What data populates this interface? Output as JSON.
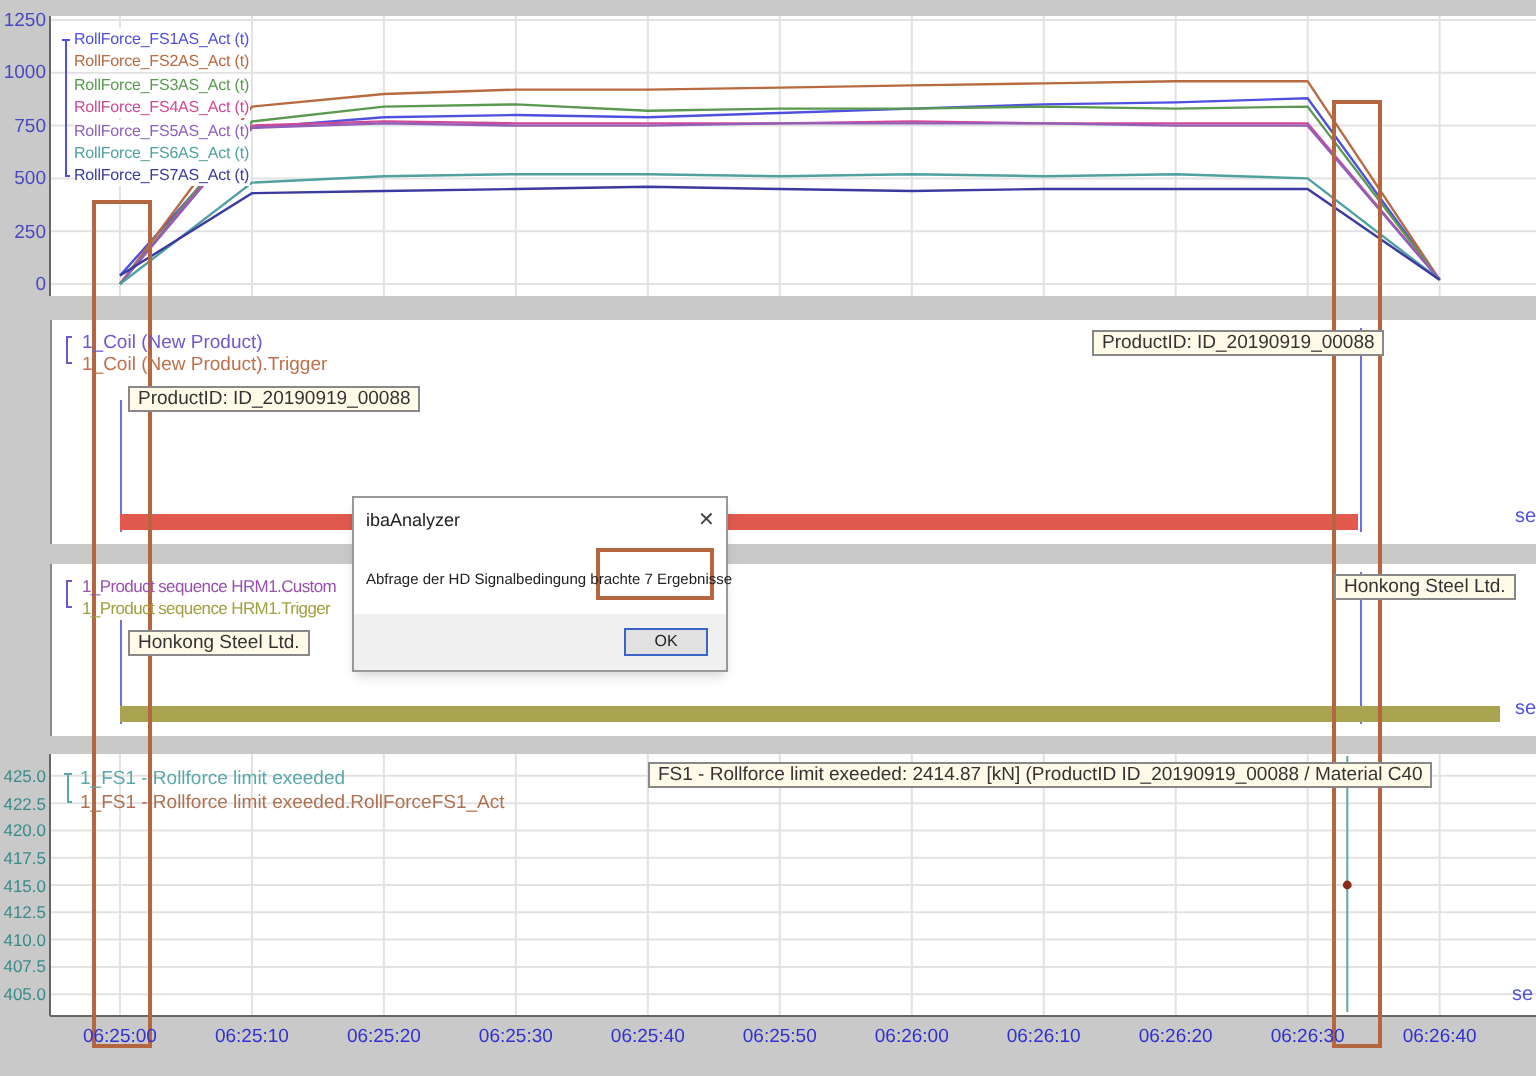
{
  "force_panel": {
    "chart_data": {
      "type": "line",
      "grid": true,
      "categories": [
        null,
        null,
        null,
        null,
        null,
        null,
        null,
        null,
        null,
        null,
        null
      ],
      "ylim": [
        -57,
        1269
      ],
      "yticks": [
        0,
        250,
        500,
        750,
        1000,
        1250
      ],
      "series": [
        {
          "name": "RollForce_FS1AS_Act (t)",
          "color": "#5050e0",
          "values": [
            40,
            740,
            790,
            800,
            790,
            810,
            830,
            850,
            860,
            880,
            20
          ]
        },
        {
          "name": "RollForce_FS2AS_Act (t)",
          "color": "#b86a40",
          "values": [
            0,
            840,
            900,
            920,
            920,
            930,
            940,
            950,
            960,
            960,
            20
          ]
        },
        {
          "name": "RollForce_FS3AS_Act (t)",
          "color": "#5a9a50",
          "values": [
            0,
            770,
            840,
            850,
            820,
            830,
            830,
            840,
            830,
            840,
            20
          ]
        },
        {
          "name": "RollForce_FS4AS_Act (t)",
          "color": "#d04898",
          "values": [
            0,
            750,
            770,
            760,
            760,
            760,
            770,
            760,
            760,
            760,
            20
          ]
        },
        {
          "name": "RollForce_FS5AS_Act (t)",
          "color": "#9060b8",
          "values": [
            0,
            740,
            760,
            750,
            750,
            760,
            760,
            760,
            750,
            750,
            20
          ]
        },
        {
          "name": "RollForce_FS6AS_Act (t)",
          "color": "#50a0a0",
          "values": [
            0,
            480,
            510,
            520,
            520,
            510,
            520,
            510,
            520,
            500,
            20
          ]
        },
        {
          "name": "RollForce_FS7AS_Act (t)",
          "color": "#3a3aa0",
          "values": [
            40,
            430,
            440,
            450,
            460,
            450,
            440,
            450,
            450,
            450,
            20
          ]
        }
      ]
    }
  },
  "coil_panel": {
    "kind": "coil",
    "legend": [
      {
        "label": "1_Coil (New Product)",
        "color": "#6a5ad0"
      },
      {
        "label": "1_Coil (New Product).Trigger",
        "color": "#c0704a"
      }
    ],
    "annotations": [
      "ProductID: ID_20190919_00088",
      "ProductID: ID_20190919_00088"
    ],
    "unit": "se"
  },
  "sequence_panel": {
    "kind": "sequence",
    "legend": [
      {
        "label": "1_Product sequence HRM1.Custom",
        "color": "#9a50b0"
      },
      {
        "label": "1_Product sequence HRM1.Trigger",
        "color": "#a0a040"
      }
    ],
    "annotations": [
      "Honkong Steel Ltd.",
      "Honkong Steel Ltd."
    ],
    "unit": "se"
  },
  "limit_panel": {
    "event_legend": {
      "label": "1_FS1 - Rollforce limit exeeded",
      "color": "#5aa8a8"
    },
    "annotation": "FS1 - Rollforce limit exeeded: 2414.87 [kN] (ProductID ID_20190919_00088 / Material C40",
    "unit": "se",
    "chart_data": {
      "type": "scatter",
      "grid": true,
      "ref_lines": [
        {
          "axis": "x",
          "value": 23193,
          "color": "#5aa8a8"
        }
      ],
      "x": [
        23193
      ],
      "xlim": [
        23094.7,
        23207.3
      ],
      "ylim": [
        403,
        427
      ],
      "yticks": [
        {
          "value": 405,
          "label": "405.0"
        },
        {
          "value": 407.5,
          "label": "407.5"
        },
        {
          "value": 410,
          "label": "410.0"
        },
        {
          "value": 412.5,
          "label": "412.5"
        },
        {
          "value": 415,
          "label": "415.0"
        },
        {
          "value": 417.5,
          "label": "417.5"
        },
        {
          "value": 420,
          "label": "420.0"
        },
        {
          "value": 422.5,
          "label": "422.5"
        },
        {
          "value": 425,
          "label": "425.0"
        }
      ],
      "xticks": [
        {
          "value": 23100,
          "label": "06:25:00"
        },
        {
          "value": 23110,
          "label": "06:25:10"
        },
        {
          "value": 23120,
          "label": "06:25:20"
        },
        {
          "value": 23130,
          "label": "06:25:30"
        },
        {
          "value": 23140,
          "label": "06:25:40"
        },
        {
          "value": 23150,
          "label": "06:25:50"
        },
        {
          "value": 23160,
          "label": "06:26:00"
        },
        {
          "value": 23170,
          "label": "06:26:10"
        },
        {
          "value": 23180,
          "label": "06:26:20"
        },
        {
          "value": 23190,
          "label": "06:26:30"
        },
        {
          "value": 23200,
          "label": "06:26:40"
        }
      ],
      "series": [
        {
          "name": "1_FS1 - Rollforce limit exeeded.RollForceFS1_Act",
          "color": "#8b2a1a",
          "values": [
            415
          ]
        }
      ]
    }
  },
  "dialog": {
    "title": "ibaAnalyzer",
    "close": "✕",
    "message": "Abfrage der HD Signalbedingung brachte 7 Ergebnisse",
    "buttons": [
      "OK"
    ]
  }
}
